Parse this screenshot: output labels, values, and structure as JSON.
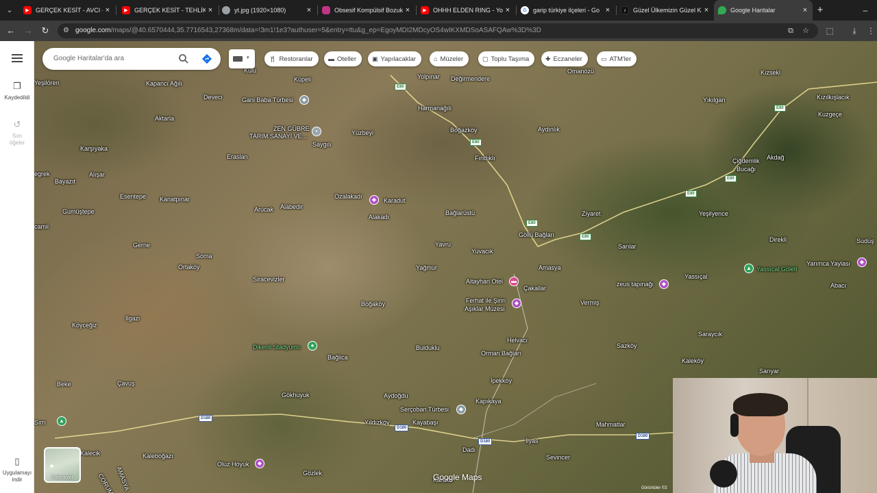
{
  "browser": {
    "tabs": [
      {
        "title": "GERÇEK KESİT - AVCI - Yo",
        "favicon": "youtube-icon",
        "color": "#ff0000"
      },
      {
        "title": "GERÇEK KESİT - TEHLİKELİ",
        "favicon": "youtube-icon",
        "color": "#ff0000"
      },
      {
        "title": "yt.jpg (1920×1080)",
        "favicon": "globe-icon",
        "color": "#9aa0a6"
      },
      {
        "title": "Obsesif Kompülsif Bozukl",
        "favicon": "instagram-icon",
        "color": "#c13584"
      },
      {
        "title": "OHHH ELDEN RING - You",
        "favicon": "youtube-icon",
        "color": "#ff0000"
      },
      {
        "title": "garip türkiye ilçeleri - Go",
        "favicon": "google-icon",
        "color": "#4285f4"
      },
      {
        "title": "Güzel Ülkemizin Güzel Ka",
        "favicon": "tiktok-icon",
        "color": "#111111"
      },
      {
        "title": "Google Haritalar",
        "favicon": "google-maps-icon",
        "color": "#34a853",
        "active": true
      }
    ],
    "url_host": "google.com",
    "url_rest": "/maps/@40.6570444,35.7716543,27368m/data=!3m1!1e3?authuser=5&entry=ttu&g_ep=EgoyMDI2MDcyOS4wIKXMDSoASAFQAw%3D%3D"
  },
  "sidebar": {
    "saved_label": "Kaydedildi",
    "recent_label": "Son öğeler",
    "get_app_label": "Uygulamayı indir"
  },
  "search": {
    "placeholder": "Google Haritalar'da ara"
  },
  "chips": [
    {
      "label": "Restoranlar",
      "icon": "fork-knife-icon"
    },
    {
      "label": "Oteller",
      "icon": "bed-icon"
    },
    {
      "label": "Yapılacaklar",
      "icon": "camera-icon"
    },
    {
      "label": "Müzeler",
      "icon": "museum-icon"
    },
    {
      "label": "Toplu Taşıma",
      "icon": "transit-icon"
    },
    {
      "label": "Eczaneler",
      "icon": "pharmacy-icon"
    },
    {
      "label": "ATM'ler",
      "icon": "atm-icon"
    }
  ],
  "layers_label": "Katmanlar",
  "logo": "Google Maps",
  "attribution": "Görüntüler ©2",
  "places": [
    "Kulu",
    "Küpeli",
    "Yolpınar",
    "Değirmendere",
    "Omanözü",
    "Kızseki",
    "Yeşilören",
    "Kapancı Ağılı",
    "Deveci",
    "Gani Baba Türbesi",
    "Harmanağılı",
    "Yıkılgan",
    "Kızılkışlacık",
    "Kuzgeçe",
    "Aktarla",
    "ZEN GÜBRE",
    "TARIM SANAYİ VE...",
    "Saygılı",
    "Yüzbeyi",
    "Boğazköy",
    "Aydınlık",
    "Karşıyaka",
    "Eraslan",
    "Fındıklı",
    "Çiğdemlik",
    "Bucağı",
    "Akdağ",
    "egrek",
    "Alışar",
    "Bayazıt",
    "Esentepe",
    "Kanatpınar",
    "Ozalakadı",
    "Karadut",
    "Arucak",
    "Alabedir",
    "Alakadı",
    "Bağlarüstü",
    "Ziyaret",
    "Yeşilyence",
    "Gumüştepe",
    "camii",
    "Göllü Bağları",
    "Direkli",
    "Sudüş",
    "Gerne",
    "Soma",
    "Yavru",
    "Yuvacık",
    "Sarılar",
    "Ortaköy",
    "Yağmur",
    "Amasya",
    "Yarımca Yaylası",
    "Yassıcal Göleti",
    "Siracevizler",
    "Altayhan Otel",
    "Çakallar",
    "zeus tapınağı",
    "Yassıçal",
    "Abacı",
    "Boğaköy",
    "Ferhat ile Şirin",
    "Aşıklar Müzesi",
    "Vermiş",
    "Ilgazi",
    "Köyceğiz",
    "Helvacı",
    "Saraycık",
    "Dikenli Stadyumu",
    "Bulduklu",
    "Sazköy",
    "Bağlica",
    "Orman Bağları",
    "Kaleköy",
    "Beke",
    "Çavuş",
    "İpekköy",
    "Sarıyar",
    "Gökhuyuk",
    "Aydoğdu",
    "Kapıkaya",
    "Sırrı",
    "Serçoban Türbesi",
    "Yıldızköy",
    "Kayabaşı",
    "Mahmatlar",
    "Kalecik",
    "İlyas",
    "Sevincer",
    "Kaleboğazı",
    "Oluz Höyük",
    "Dadı",
    "Gözlek",
    "CORUM",
    "AMASYA",
    "Karakö"
  ],
  "roads": [
    "E80",
    "D180"
  ]
}
